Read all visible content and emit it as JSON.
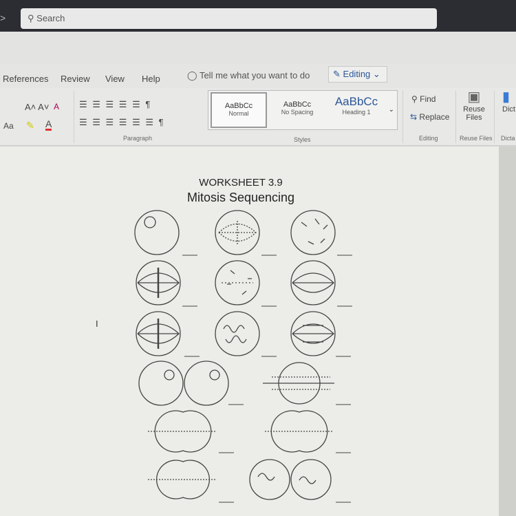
{
  "titlebar": {
    "back": ">",
    "search_placeholder": "Search"
  },
  "tabs": [
    "References",
    "Review",
    "View",
    "Help"
  ],
  "tell_me": "Tell me what you want to do",
  "mode": "Editing",
  "ribbon": {
    "paragraph_group": "Paragraph",
    "styles": [
      {
        "sample": "AaBbCc",
        "name": "Normal"
      },
      {
        "sample": "AaBbCc",
        "name": "No Spacing"
      },
      {
        "sample": "AaBbCc",
        "name": "Heading 1"
      }
    ],
    "styles_group": "Styles",
    "find": "Find",
    "replace": "Replace",
    "editing_group": "Editing",
    "reuse_files": "Reuse Files",
    "reuse_group": "Reuse Files",
    "dictate": "Dict",
    "dictate_group": "Dicta",
    "font_case": "Aa"
  },
  "worksheet": {
    "title": "WORKSHEET 3.9",
    "subtitle": "Mitosis Sequencing"
  }
}
